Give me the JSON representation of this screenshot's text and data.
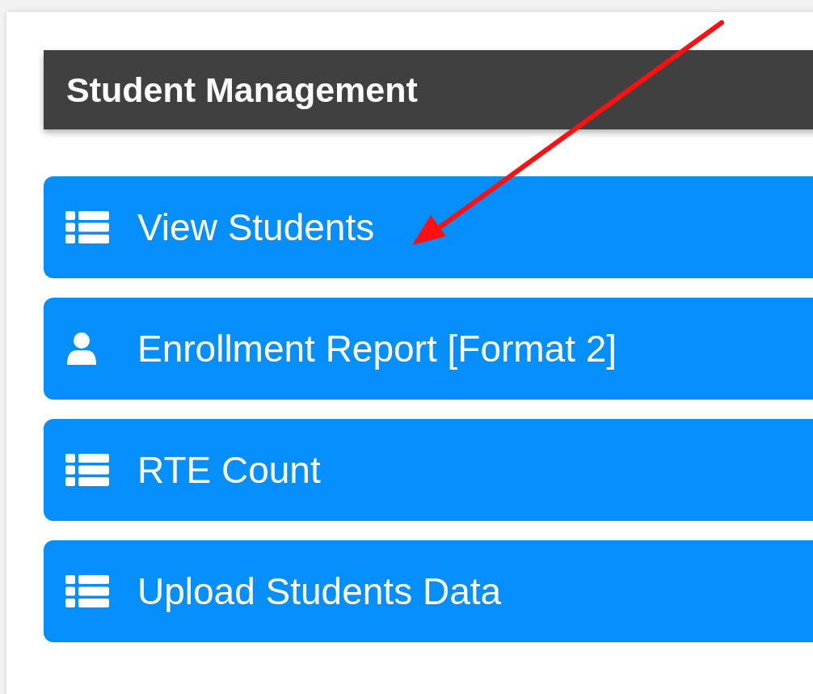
{
  "panel": {
    "title": "Student Management"
  },
  "menu": [
    {
      "label": "View Students",
      "kind": "list"
    },
    {
      "label": "Enrollment Report [Format 2]",
      "kind": "person"
    },
    {
      "label": "RTE Count",
      "kind": "list"
    },
    {
      "label": "Upload Students Data",
      "kind": "list"
    }
  ]
}
